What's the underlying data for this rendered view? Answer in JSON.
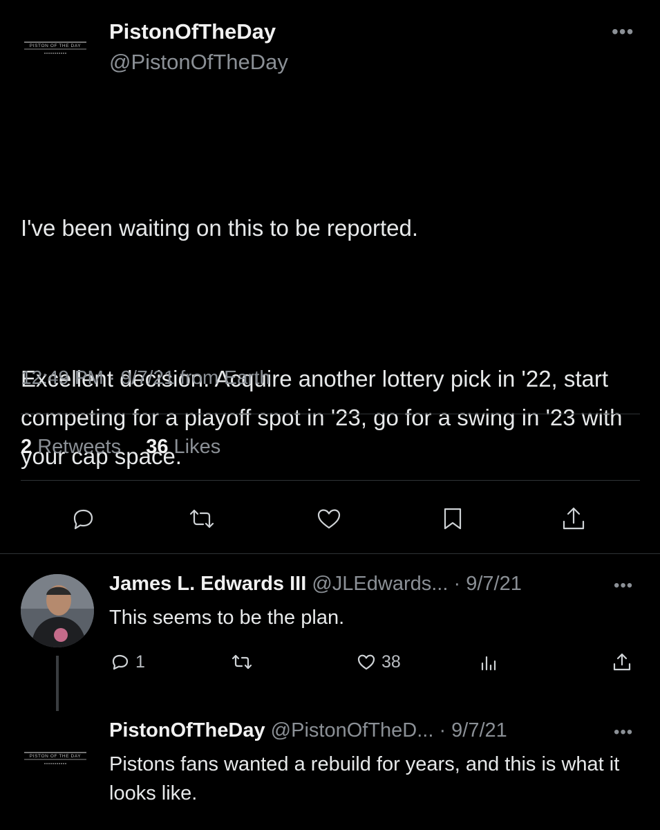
{
  "tweet": {
    "author_name": "PistonOfTheDay",
    "author_handle": "@PistonOfTheDay",
    "logo_text": "PISTON OF THE DAY",
    "more_label": "•••",
    "paragraph1": "I've been waiting on this to be reported.",
    "paragraph2": "Excellent decision. Acquire another lottery pick in '22, start competing for a playoff spot in '23, go for a swing in '23 with your cap space.",
    "timestamp": "12:49 PM · 9/7/21 from Earth",
    "retweets_count": "2",
    "retweets_label": "Retweets",
    "likes_count": "36",
    "likes_label": "Likes"
  },
  "replies": [
    {
      "name": "James L. Edwards III",
      "handle": "@JLEdwards... · 9/7/21",
      "more_label": "•••",
      "text": "This seems to be the plan.",
      "reply_count": "1",
      "like_count": "38"
    },
    {
      "name": "PistonOfTheDay",
      "handle": "@PistonOfTheD... · 9/7/21",
      "more_label": "•••",
      "logo_text": "PISTON OF THE DAY",
      "text": "Pistons fans wanted a rebuild for years, and this is what it looks like."
    }
  ],
  "icons": [
    "reply-icon",
    "retweet-icon",
    "like-icon",
    "bookmark-icon",
    "share-icon",
    "analytics-icon",
    "more-icon"
  ],
  "colors": {
    "background": "#000000",
    "text": "#e7e9ea",
    "muted": "#8b9096",
    "divider": "#2f3336"
  }
}
